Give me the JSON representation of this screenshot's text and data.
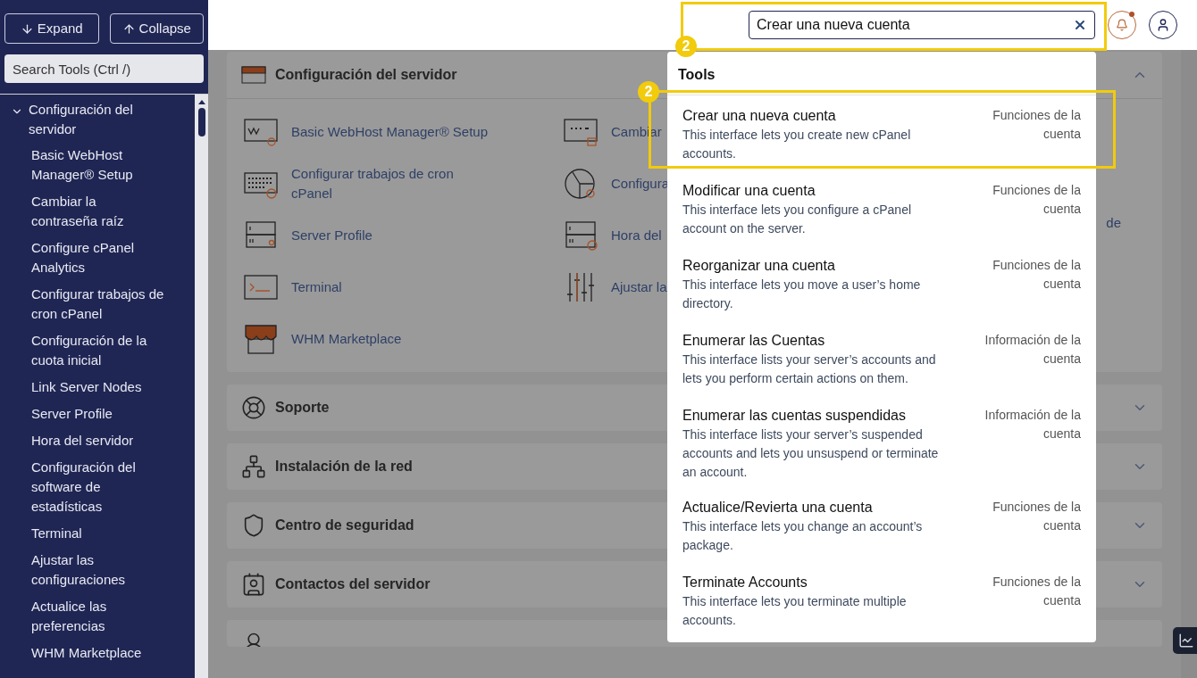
{
  "sidebar": {
    "buttons": [
      {
        "kind": "down",
        "label": "Expand"
      },
      {
        "kind": "up",
        "label": "Collapse"
      }
    ],
    "search": {
      "placeholder": "Search Tools (Ctrl /)"
    },
    "tree": [
      {
        "label": "Configuración del servidor",
        "expanded": true,
        "children": [
          {
            "label": "Basic WebHost Manager® Setup"
          },
          {
            "label": "Cambiar la contraseña raíz"
          },
          {
            "label": "Configure cPanel Analytics"
          },
          {
            "label": "Configurar trabajos de cron cPanel"
          },
          {
            "label": "Configuración de la cuota inicial"
          },
          {
            "label": "Link Server Nodes"
          },
          {
            "label": "Server Profile"
          },
          {
            "label": "Hora del servidor"
          },
          {
            "label": "Configuración del software de estadísticas"
          },
          {
            "label": "Terminal"
          },
          {
            "label": "Ajustar las configuraciones"
          },
          {
            "label": "Actualice las preferencias"
          },
          {
            "label": "WHM Marketplace"
          }
        ]
      }
    ]
  },
  "topbar": {
    "search": {
      "value": "Crear una nueva cuenta"
    },
    "notification_unread": true
  },
  "sections": [
    {
      "title": "Configuración del servidor",
      "kind": "server",
      "expanded": true,
      "tool_rows": [
        [
          {
            "label": "Basic WebHost Manager® Setup",
            "kind": "whm"
          },
          {
            "label": "Cambiar",
            "kind": "password"
          }
        ],
        [
          {
            "label": "Configurar trabajos de cron cPanel",
            "kind": "keyboard"
          },
          {
            "label": "Configura",
            "kind": "pie"
          }
        ],
        [
          {
            "label": "Server Profile",
            "kind": "server-user"
          },
          {
            "label": "Hora del",
            "kind": "server-clock"
          },
          {
            "label": "de"
          }
        ],
        [
          {
            "label": "Terminal",
            "kind": "terminal"
          },
          {
            "label": "Ajustar la",
            "kind": "sliders"
          }
        ],
        [
          {
            "label": "WHM Marketplace",
            "kind": "store"
          }
        ]
      ]
    },
    {
      "title": "Soporte",
      "kind": "lifebuoy",
      "expanded": false
    },
    {
      "title": "Instalación de la red",
      "kind": "network",
      "expanded": false
    },
    {
      "title": "Centro de seguridad",
      "kind": "shield",
      "expanded": false
    },
    {
      "title": "Contactos del servidor",
      "kind": "contacts",
      "expanded": false
    },
    {
      "kind": "person"
    }
  ],
  "dropdown": {
    "heading": "Tools",
    "results": [
      {
        "title": "Crear una nueva cuenta",
        "description": "This interface lets you create new cPanel accounts.",
        "category": "Funciones de la cuenta"
      },
      {
        "title": "Modificar una cuenta",
        "description": "This interface lets you configure a cPanel account on the server.",
        "category": "Funciones de la cuenta"
      },
      {
        "title": "Reorganizar una cuenta",
        "description": "This interface lets you move a user’s home directory.",
        "category": "Funciones de la cuenta"
      },
      {
        "title": "Enumerar las Cuentas",
        "description": "This interface lists your server’s accounts and lets you perform certain actions on them.",
        "category": "Información de la cuenta"
      },
      {
        "title": "Enumerar las cuentas suspendidas",
        "description": "This interface lists your server’s suspended accounts and lets you unsuspend or terminate an account.",
        "category": "Información de la cuenta"
      },
      {
        "title": "Actualice/Revierta una cuenta",
        "description": "This interface lets you change an account’s package.",
        "category": "Funciones de la cuenta"
      },
      {
        "title": "Terminate Accounts",
        "description": "This interface lets you terminate multiple accounts.",
        "category": "Funciones de la cuenta"
      }
    ]
  },
  "annotations": [
    {
      "label": "2"
    },
    {
      "label": "2"
    }
  ]
}
